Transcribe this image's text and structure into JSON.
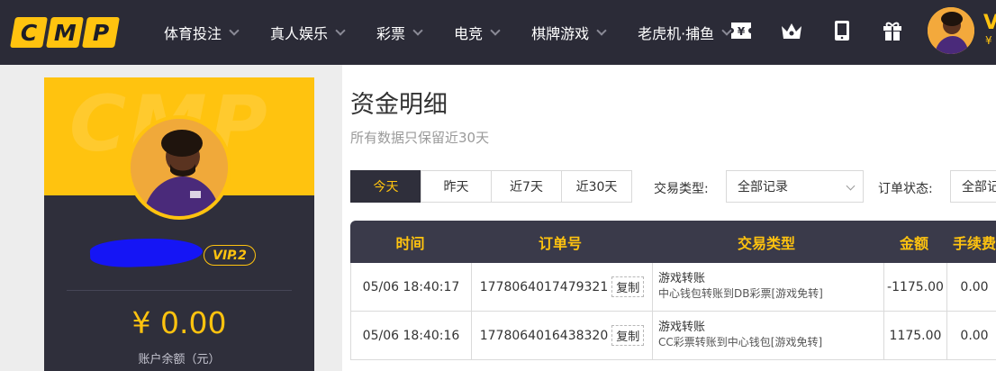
{
  "logo": {
    "letters": [
      "C",
      "M",
      "P"
    ]
  },
  "nav": {
    "items": [
      {
        "label": "体育投注"
      },
      {
        "label": "真人娱乐"
      },
      {
        "label": "彩票"
      },
      {
        "label": "电竞"
      },
      {
        "label": "棋牌游戏"
      },
      {
        "label": "老虎机·捕鱼"
      }
    ],
    "icons": [
      "ticket-yen-icon",
      "crown-icon",
      "mobile-icon",
      "gift-icon"
    ]
  },
  "user": {
    "name_initial": "V",
    "currency": "¥",
    "vip": "VIP.2",
    "balance": "¥ 0.00",
    "balance_label": "账户余额（元）",
    "watermark": "CMP"
  },
  "page": {
    "title": "资金明细",
    "subtitle": "所有数据只保留近30天"
  },
  "filters": {
    "tabs": [
      {
        "label": "今天",
        "active": true
      },
      {
        "label": "昨天",
        "active": false
      },
      {
        "label": "近7天",
        "active": false
      },
      {
        "label": "近30天",
        "active": false
      }
    ],
    "type_label": "交易类型:",
    "type_value": "全部记录",
    "status_label": "订单状态:",
    "status_value": "全部记"
  },
  "table": {
    "headers": [
      "时间",
      "订单号",
      "交易类型",
      "金额",
      "手续费"
    ],
    "copy_label": "复制",
    "rows": [
      {
        "time": "05/06 18:40:17",
        "order": "1778064017479321",
        "type": "游戏转账",
        "detail": "中心钱包转账到DB彩票[游戏免转]",
        "amount": "-1175.00",
        "fee": "0.00"
      },
      {
        "time": "05/06 18:40:16",
        "order": "1778064016438320",
        "type": "游戏转账",
        "detail": "CC彩票转账到中心钱包[游戏免转]",
        "amount": "1175.00",
        "fee": "0.00"
      }
    ]
  },
  "colors": {
    "accent": "#ffc30f",
    "dark": "#2b2b37",
    "panel": "#2f2f3b"
  }
}
